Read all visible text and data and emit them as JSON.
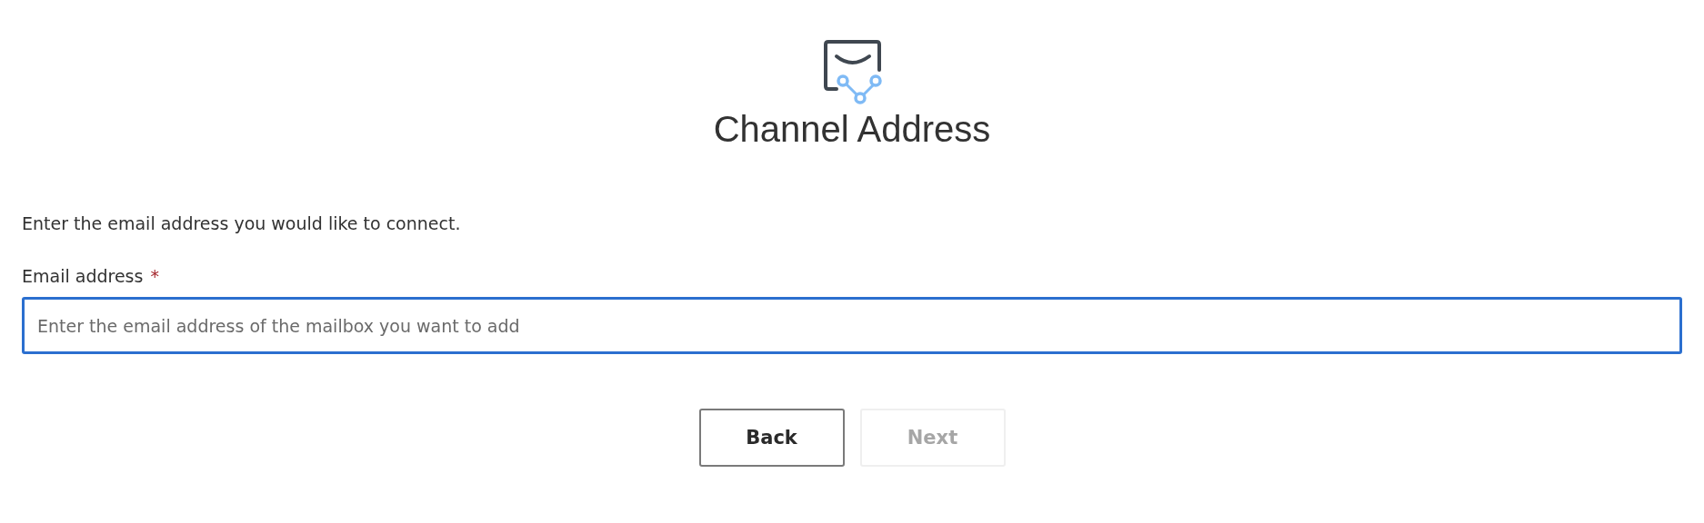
{
  "title": "Channel Address",
  "instruction": "Enter the email address you would like to connect.",
  "email_field": {
    "label": "Email address",
    "required_mark": "*",
    "placeholder": "Enter the email address of the mailbox you want to add",
    "focused": true
  },
  "buttons": [
    {
      "label": "Back",
      "disabled": false
    },
    {
      "label": "Next",
      "disabled": true
    }
  ]
}
